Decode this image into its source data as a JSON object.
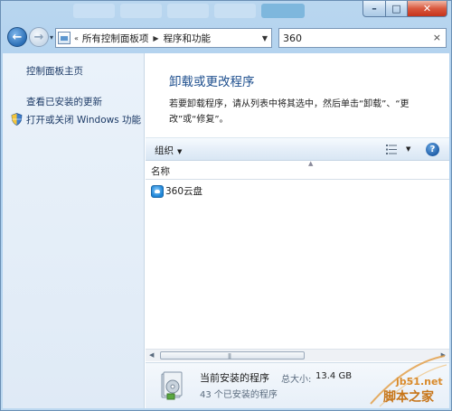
{
  "window": {
    "controls": {
      "minimize": "–",
      "maximize": "□",
      "close": "✕"
    }
  },
  "navbar": {
    "back_glyph": "←",
    "forward_glyph": "→",
    "recent_glyph": "▾",
    "breadcrumb": [
      "所有控制面板项",
      "程序和功能"
    ],
    "breadcrumb_prefix": "«",
    "breadcrumb_sep": "▶",
    "address_dropdown": "▼",
    "refresh_glyph": "↻",
    "search_value": "360",
    "search_clear": "×"
  },
  "sidebar": {
    "items": [
      {
        "label": "控制面板主页"
      },
      {
        "label": "查看已安装的更新"
      },
      {
        "label": "打开或关闭 Windows 功能",
        "icon": "shield-icon"
      }
    ]
  },
  "main": {
    "title": "卸载或更改程序",
    "description": "若要卸载程序，请从列表中将其选中，然后单击“卸载”、“更改”或“修复”。",
    "toolbar": {
      "organize_label": "组织",
      "caret": "▼",
      "help_glyph": "?"
    },
    "columns": [
      {
        "label": "名称"
      }
    ],
    "sort_glyph": "▲",
    "programs": [
      {
        "name": "360云盘",
        "icon": "cloud-disk-icon"
      }
    ],
    "scrollbar": {
      "left": "◀",
      "right": "▶",
      "grip": "|||"
    }
  },
  "status": {
    "title": "当前安装的程序",
    "size_label": "总大小:",
    "size_value": "13.4 GB",
    "count_text": "43 个已安装的程序"
  },
  "watermark": {
    "site": "jb51.net",
    "brand": "脚本之家"
  },
  "colors": {
    "accent_title": "#1e4f8e",
    "link": "#1c3a66",
    "close_button": "#d9583e",
    "watermark": "#c77518"
  }
}
